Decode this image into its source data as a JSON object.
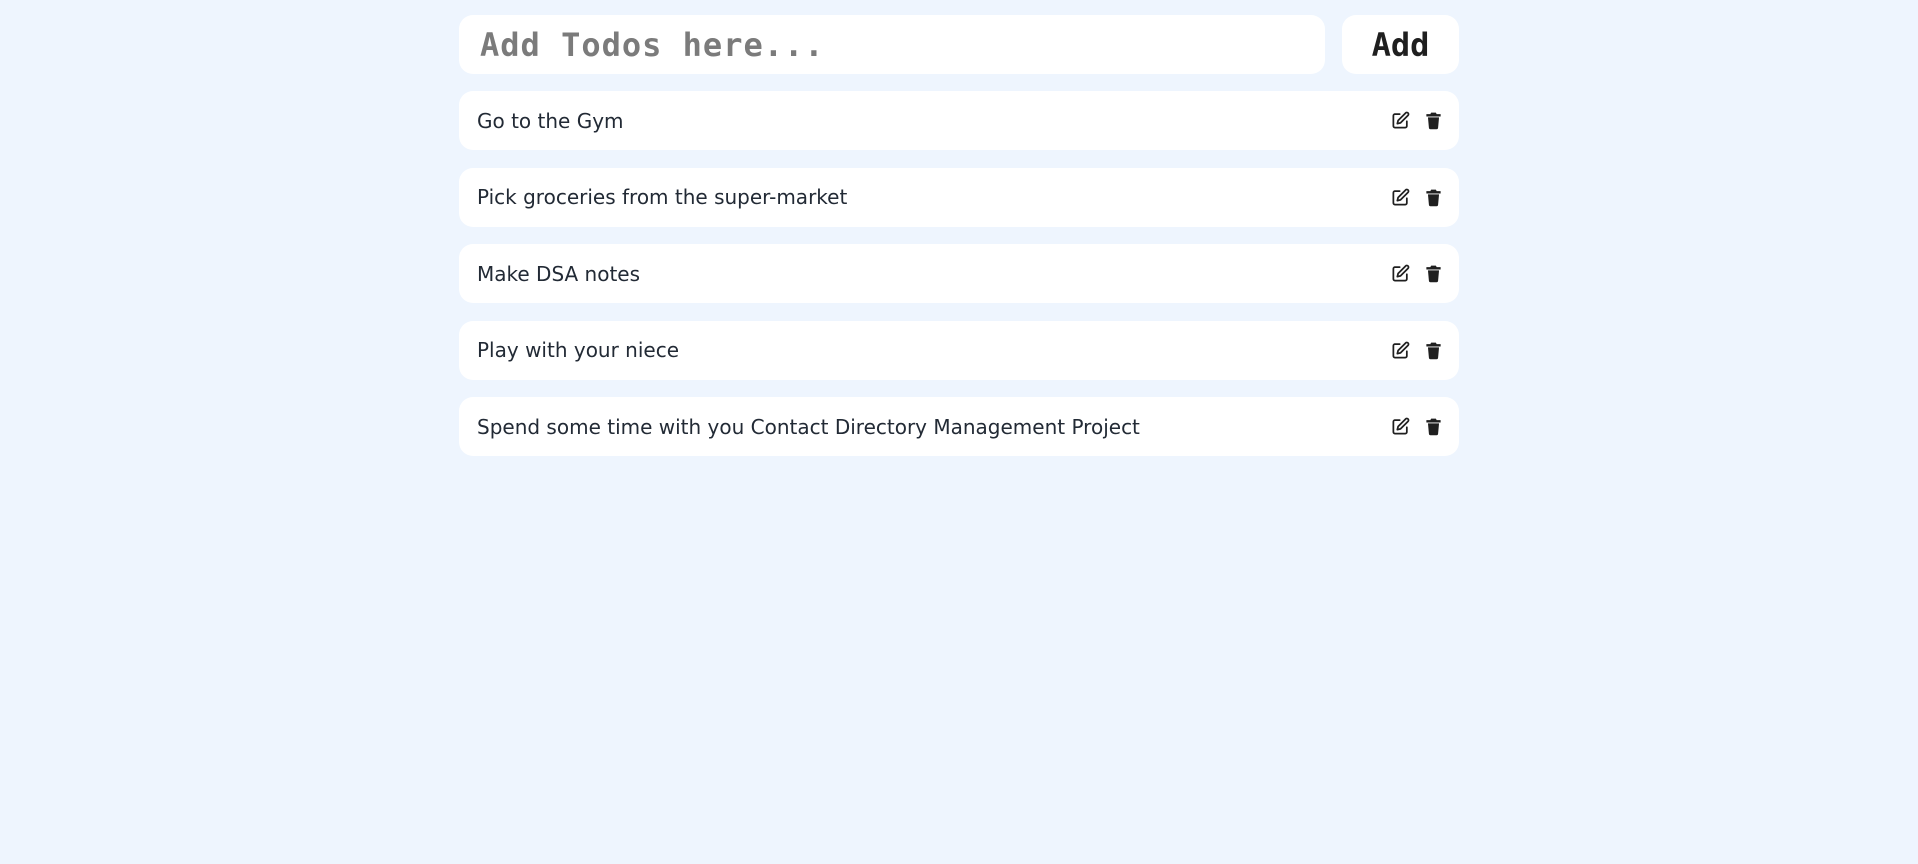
{
  "input": {
    "placeholder": "Add Todos here...",
    "value": ""
  },
  "add_button": {
    "label": "Add"
  },
  "todos": [
    {
      "text": "Go to the Gym"
    },
    {
      "text": "Pick groceries from the super-market"
    },
    {
      "text": "Make DSA notes"
    },
    {
      "text": "Play with your niece"
    },
    {
      "text": "Spend some time with you Contact Directory Management Project"
    }
  ],
  "icons": {
    "edit": "edit-icon",
    "delete": "trash-icon"
  },
  "colors": {
    "background": "#eef5fe",
    "card": "#ffffff",
    "text": "#222a35",
    "placeholder": "#7b7b7b"
  }
}
